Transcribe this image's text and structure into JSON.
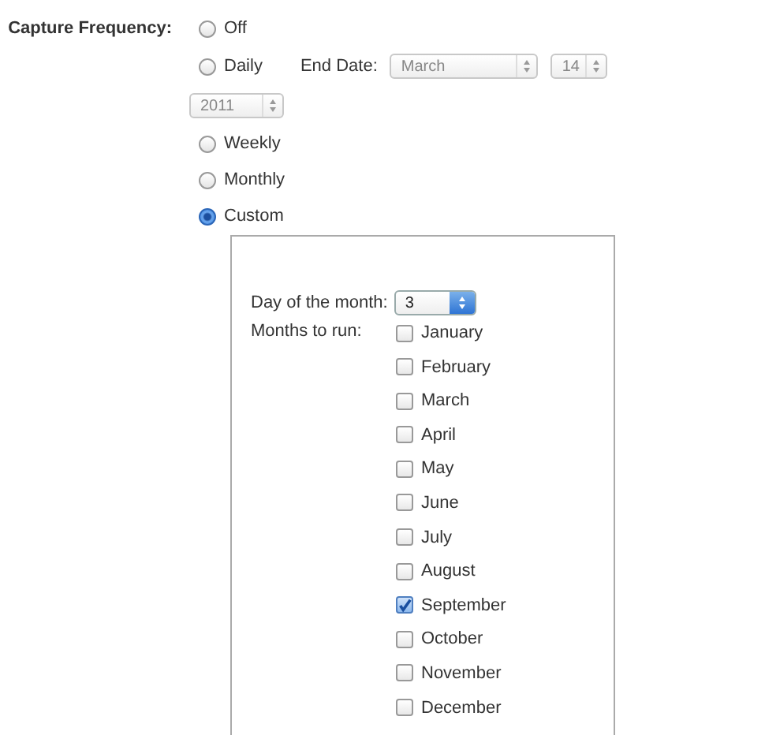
{
  "field_label": "Capture Frequency:",
  "options": [
    {
      "label": "Off",
      "selected": false
    },
    {
      "label": "Daily",
      "selected": false
    },
    {
      "label": "Weekly",
      "selected": false
    },
    {
      "label": "Monthly",
      "selected": false
    },
    {
      "label": "Custom",
      "selected": true
    }
  ],
  "end_date": {
    "label": "End Date:",
    "month": "March",
    "day": "14",
    "year": "2011"
  },
  "custom": {
    "day_label": "Day of the month:",
    "day": "3",
    "months_label": "Months to run:",
    "months": [
      {
        "label": "January",
        "checked": false
      },
      {
        "label": "February",
        "checked": false
      },
      {
        "label": "March",
        "checked": false
      },
      {
        "label": "April",
        "checked": false
      },
      {
        "label": "May",
        "checked": false
      },
      {
        "label": "June",
        "checked": false
      },
      {
        "label": "July",
        "checked": false
      },
      {
        "label": "August",
        "checked": false
      },
      {
        "label": "September",
        "checked": true
      },
      {
        "label": "October",
        "checked": false
      },
      {
        "label": "November",
        "checked": false
      },
      {
        "label": "December",
        "checked": false
      }
    ]
  }
}
